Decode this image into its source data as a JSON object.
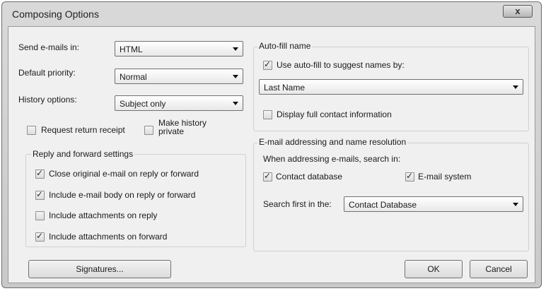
{
  "window": {
    "title": "Composing Options",
    "close_label": "x"
  },
  "send_format": {
    "label": "Send e-mails in:",
    "value": "HTML"
  },
  "priority": {
    "label": "Default priority:",
    "value": "Normal"
  },
  "history": {
    "label": "History options:",
    "value": "Subject only"
  },
  "request_receipt": {
    "label": "Request return receipt",
    "checked": false
  },
  "history_private": {
    "label_line1": "Make history",
    "label_line2": "private",
    "checked": false
  },
  "reply_group": {
    "title": "Reply and forward settings",
    "items": [
      {
        "label": "Close original e-mail on reply or forward",
        "checked": true
      },
      {
        "label": "Include e-mail body on reply or forward",
        "checked": true
      },
      {
        "label": "Include attachments on reply",
        "checked": false
      },
      {
        "label": "Include attachments on forward",
        "checked": true
      }
    ]
  },
  "autofill": {
    "title": "Auto-fill name",
    "use_label": "Use auto-fill to suggest names by:",
    "use_checked": true,
    "select_value": "Last Name",
    "display_label": "Display full contact information",
    "display_checked": false
  },
  "addressing": {
    "title": "E-mail addressing and name resolution",
    "search_in_label": "When addressing e-mails, search in:",
    "contact_db_label": "Contact database",
    "contact_db_checked": true,
    "email_system_label": "E-mail system",
    "email_system_checked": true,
    "search_first_label": "Search first in the:",
    "search_first_value": "Contact Database"
  },
  "buttons": {
    "signatures": "Signatures...",
    "ok": "OK",
    "cancel": "Cancel"
  },
  "check_glyph": "✓"
}
